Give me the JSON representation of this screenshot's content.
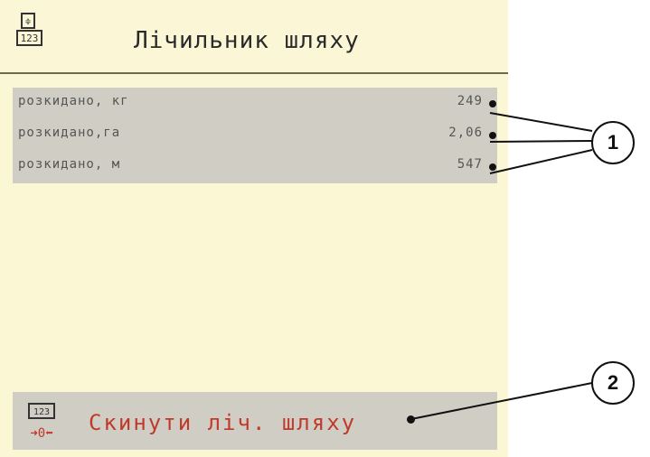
{
  "header": {
    "title": "Лічильник шляху",
    "icon": "counter-icon"
  },
  "rows": [
    {
      "label": "розкидано, кг",
      "value": "249"
    },
    {
      "label": "розкидано,га",
      "value": "2,06"
    },
    {
      "label": "розкидано, м",
      "value": "547"
    }
  ],
  "footer": {
    "label": "Скинути ліч. шляху",
    "icon": "reset-counter-icon"
  },
  "callouts": {
    "first": "1",
    "second": "2"
  },
  "colors": {
    "screen_bg": "#fbf7d4",
    "panel_bg": "#d0cec4",
    "reset_text": "#c0392b"
  }
}
